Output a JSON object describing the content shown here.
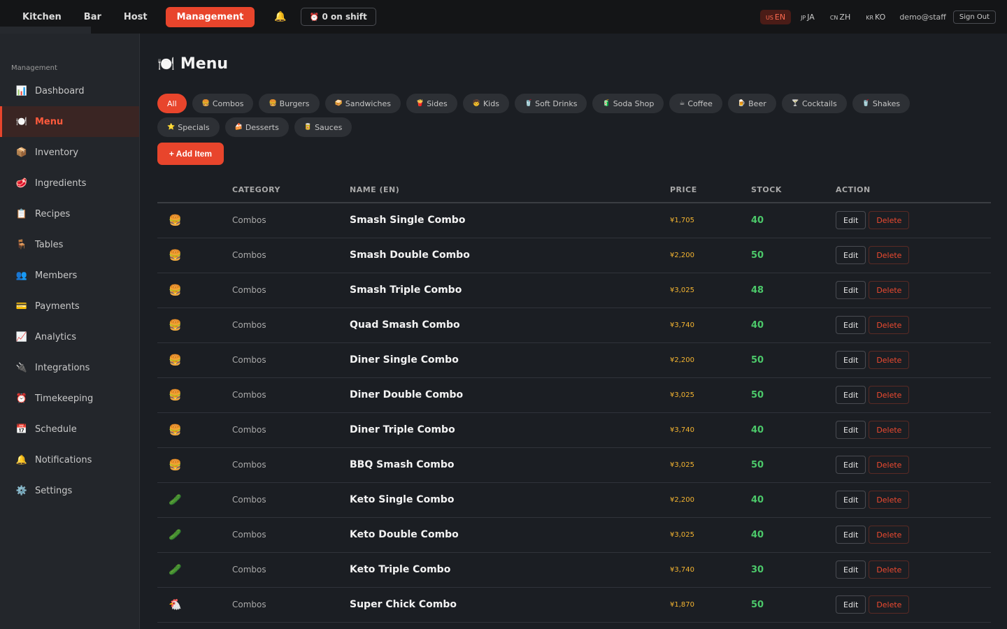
{
  "topnav": {
    "tabs": [
      {
        "label": "Kitchen",
        "active": false
      },
      {
        "label": "Bar",
        "active": false
      },
      {
        "label": "Host",
        "active": false
      },
      {
        "label": "Management",
        "active": true
      }
    ],
    "bell_icon": "🔔",
    "shift_icon": "⏰",
    "shift_label": "0 on shift",
    "languages": [
      {
        "cc": "US",
        "label": "EN",
        "active": true
      },
      {
        "cc": "JP",
        "label": "JA",
        "active": false
      },
      {
        "cc": "CN",
        "label": "ZH",
        "active": false
      },
      {
        "cc": "KR",
        "label": "KO",
        "active": false
      }
    ],
    "user": "demo@staff",
    "sign_out": "Sign Out"
  },
  "sidebar": {
    "section": "Management",
    "items": [
      {
        "icon": "📊",
        "label": "Dashboard",
        "active": false
      },
      {
        "icon": "🍽️",
        "label": "Menu",
        "active": true
      },
      {
        "icon": "📦",
        "label": "Inventory",
        "active": false
      },
      {
        "icon": "🥩",
        "label": "Ingredients",
        "active": false
      },
      {
        "icon": "📋",
        "label": "Recipes",
        "active": false
      },
      {
        "icon": "🪑",
        "label": "Tables",
        "active": false
      },
      {
        "icon": "👥",
        "label": "Members",
        "active": false
      },
      {
        "icon": "💳",
        "label": "Payments",
        "active": false
      },
      {
        "icon": "📈",
        "label": "Analytics",
        "active": false
      },
      {
        "icon": "🔌",
        "label": "Integrations",
        "active": false
      },
      {
        "icon": "⏰",
        "label": "Timekeeping",
        "active": false
      },
      {
        "icon": "📅",
        "label": "Schedule",
        "active": false
      },
      {
        "icon": "🔔",
        "label": "Notifications",
        "active": false
      },
      {
        "icon": "⚙️",
        "label": "Settings",
        "active": false
      }
    ]
  },
  "main": {
    "title_icon": "🍽️",
    "title": "Menu",
    "chips": [
      {
        "icon": "",
        "label": "All",
        "active": true
      },
      {
        "icon": "🍔",
        "label": "Combos",
        "active": false
      },
      {
        "icon": "🍔",
        "label": "Burgers",
        "active": false
      },
      {
        "icon": "🥪",
        "label": "Sandwiches",
        "active": false
      },
      {
        "icon": "🍟",
        "label": "Sides",
        "active": false
      },
      {
        "icon": "🧒",
        "label": "Kids",
        "active": false
      },
      {
        "icon": "🥤",
        "label": "Soft Drinks",
        "active": false
      },
      {
        "icon": "🧃",
        "label": "Soda Shop",
        "active": false
      },
      {
        "icon": "☕",
        "label": "Coffee",
        "active": false
      },
      {
        "icon": "🍺",
        "label": "Beer",
        "active": false
      },
      {
        "icon": "🍸",
        "label": "Cocktails",
        "active": false
      },
      {
        "icon": "🥤",
        "label": "Shakes",
        "active": false
      },
      {
        "icon": "⭐",
        "label": "Specials",
        "active": false
      },
      {
        "icon": "🍰",
        "label": "Desserts",
        "active": false
      },
      {
        "icon": "🥫",
        "label": "Sauces",
        "active": false
      }
    ],
    "add_item": "+ Add Item",
    "table": {
      "headers": [
        "",
        "CATEGORY",
        "NAME (EN)",
        "PRICE",
        "STOCK",
        "ACTION"
      ],
      "edit_label": "Edit",
      "delete_label": "Delete",
      "rows": [
        {
          "icon": "🍔",
          "category": "Combos",
          "name": "Smash Single Combo",
          "price": "¥1,705",
          "stock": "40"
        },
        {
          "icon": "🍔",
          "category": "Combos",
          "name": "Smash Double Combo",
          "price": "¥2,200",
          "stock": "50"
        },
        {
          "icon": "🍔",
          "category": "Combos",
          "name": "Smash Triple Combo",
          "price": "¥3,025",
          "stock": "48"
        },
        {
          "icon": "🍔",
          "category": "Combos",
          "name": "Quad Smash Combo",
          "price": "¥3,740",
          "stock": "40"
        },
        {
          "icon": "🍔",
          "category": "Combos",
          "name": "Diner Single Combo",
          "price": "¥2,200",
          "stock": "50"
        },
        {
          "icon": "🍔",
          "category": "Combos",
          "name": "Diner Double Combo",
          "price": "¥3,025",
          "stock": "50"
        },
        {
          "icon": "🍔",
          "category": "Combos",
          "name": "Diner Triple Combo",
          "price": "¥3,740",
          "stock": "40"
        },
        {
          "icon": "🍔",
          "category": "Combos",
          "name": "BBQ Smash Combo",
          "price": "¥3,025",
          "stock": "50"
        },
        {
          "icon": "🥒",
          "category": "Combos",
          "name": "Keto Single Combo",
          "price": "¥2,200",
          "stock": "40"
        },
        {
          "icon": "🥒",
          "category": "Combos",
          "name": "Keto Double Combo",
          "price": "¥3,025",
          "stock": "40"
        },
        {
          "icon": "🥒",
          "category": "Combos",
          "name": "Keto Triple Combo",
          "price": "¥3,740",
          "stock": "30"
        },
        {
          "icon": "🐔",
          "category": "Combos",
          "name": "Super Chick Combo",
          "price": "¥1,870",
          "stock": "50"
        }
      ]
    }
  }
}
